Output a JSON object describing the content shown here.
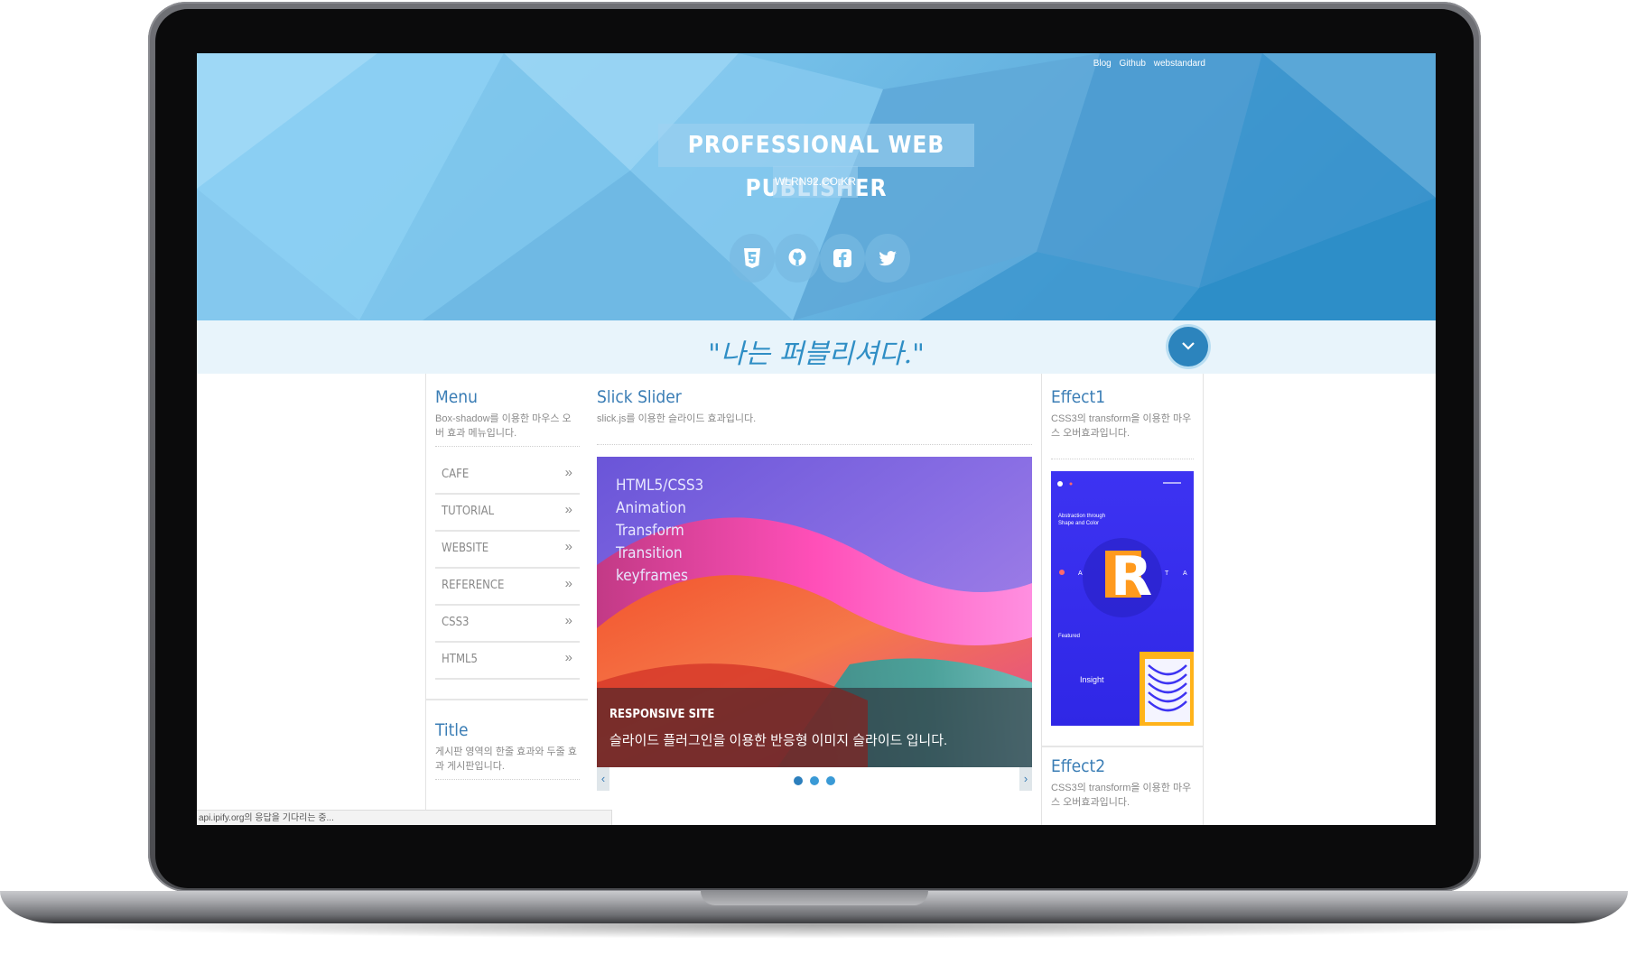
{
  "header": {
    "links": [
      "Blog",
      "Github",
      "webstandard"
    ],
    "title": "PROFESSIONAL WEB PUBLISHER",
    "url": "WLRN92.CO.KR",
    "social_icons": [
      "html5-icon",
      "github-icon",
      "facebook-icon",
      "twitter-icon"
    ]
  },
  "quote": "\"나는 퍼블리셔다.\"",
  "menu": {
    "title": "Menu",
    "desc": "Box-shadow를 이용한 마우스 오버 효과 메뉴입니다.",
    "items": [
      "CAFE",
      "TUTORIAL",
      "WEBSITE",
      "REFERENCE",
      "CSS3",
      "HTML5"
    ],
    "arrow": "»"
  },
  "board": {
    "title": "Title",
    "desc": "게시판 영역의 한줄 효과와 두줄 효과 게시판입니다."
  },
  "slider": {
    "title": "Slick Slider",
    "desc": "slick.js를 이용한 슬라이드 효과입니다.",
    "lines": [
      "HTML5/CSS3",
      "Animation",
      "Transform",
      "Transition",
      "keyframes"
    ],
    "caption_title": "RESPONSIVE SITE",
    "caption_text": "슬라이드 플러그인을 이용한 반응형 이미지 슬라이드 입니다.",
    "prev": "‹",
    "next": "›",
    "pages": 3,
    "active_page": 1
  },
  "effect1": {
    "title": "Effect1",
    "desc": "CSS3의 transform을 이용한 마우스 오버효과입니다.",
    "thumb": {
      "heading": "Abstraction through Shape and Color",
      "letter": "R",
      "side_left": "A",
      "side_right1": "T",
      "side_right2": "A",
      "featured": "Featured",
      "insight": "Insight"
    }
  },
  "effect2": {
    "title": "Effect2",
    "desc": "CSS3의 transform을 이용한 마우스 오버효과입니다."
  },
  "status": "api.ipify.org의 응답을 기다리는 중...",
  "colors": {
    "accent": "#2c84bd",
    "heading": "#3a7db5",
    "hero": "#74bfe8"
  }
}
